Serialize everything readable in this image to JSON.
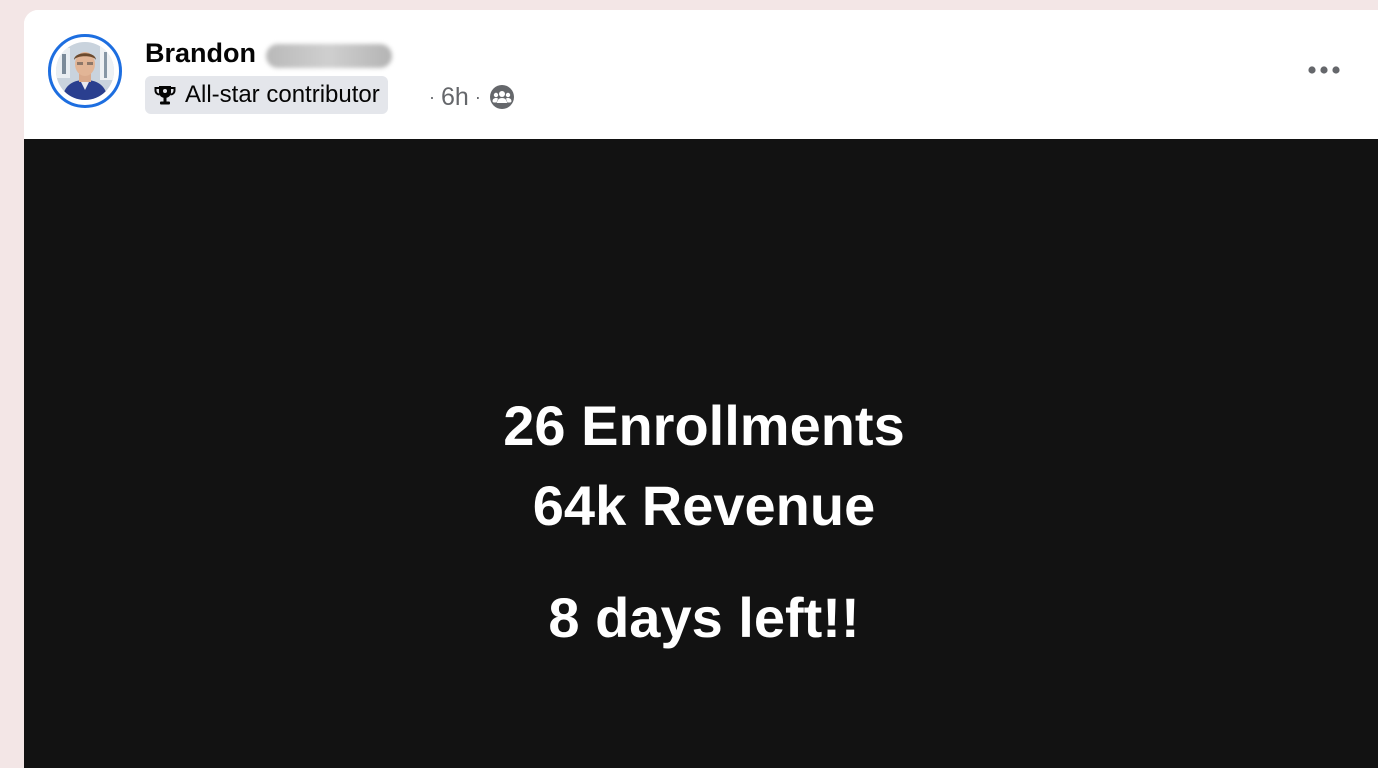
{
  "post": {
    "author": {
      "first_name": "Brandon",
      "badge_label": "All-star contributor",
      "badge_icon": "trophy-icon"
    },
    "time_ago": "6h",
    "separator": "·",
    "audience_icon": "group-icon",
    "more_icon": "more-options-icon",
    "media_lines": [
      "26 Enrollments",
      "64k Revenue",
      "8 days left!!"
    ]
  },
  "colors": {
    "page_background": "#f3e6e6",
    "avatar_ring": "#1d6ee0",
    "badge_background": "#e4e6eb",
    "meta_text": "#65676b",
    "media_background": "#121212",
    "media_text": "#ffffff"
  }
}
